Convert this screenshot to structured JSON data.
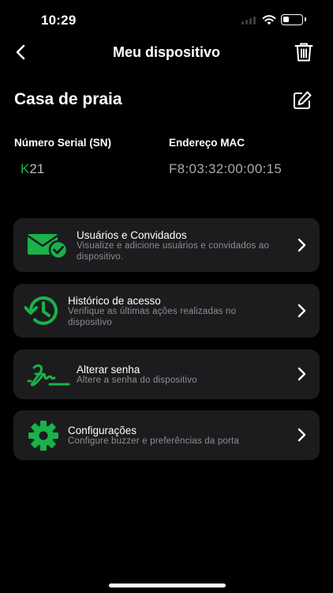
{
  "status_bar": {
    "time": "10:29"
  },
  "header": {
    "title": "Meu dispositivo"
  },
  "device": {
    "name": "Casa de praia",
    "serial_label": "Número Serial (SN)",
    "serial_prefix": "K",
    "serial_rest": "21",
    "mac_label": "Endereço MAC",
    "mac_value": "F8:03:32:00:00:15"
  },
  "menu": [
    {
      "title": "Usuários e Convidados",
      "description": "Visualize e adicione usuários e convidados ao dispositivo.",
      "icon": "mail-check-icon"
    },
    {
      "title": "Histórico de acesso",
      "description": "Verifique as últimas ações realizadas no dispositivo",
      "icon": "history-icon"
    },
    {
      "title": "Alterar senha",
      "description": "Altere a senha do dispositivo",
      "icon": "signature-icon"
    },
    {
      "title": "Configurações",
      "description": "Configure buzzer e preferências da porta",
      "icon": "gear-icon"
    }
  ],
  "colors": {
    "accent": "#19b24b",
    "card": "#1c1c1e",
    "background": "#000000",
    "muted": "#8e8e93"
  }
}
